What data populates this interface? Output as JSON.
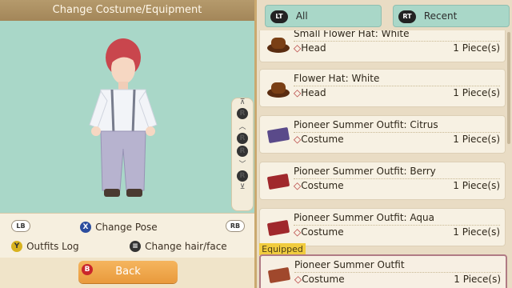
{
  "header": {
    "title": "Change Costume/Equipment"
  },
  "controls": {
    "lb": "LB",
    "rb": "RB",
    "x_button": "X",
    "y_button": "Y",
    "change_pose": "Change Pose",
    "outfits_log": "Outfits Log",
    "change_hair": "Change hair/face"
  },
  "back": {
    "button_letter": "B",
    "label": "Back"
  },
  "dpad": {
    "top_label": "R",
    "bottom_label": "R",
    "mid_label": "R"
  },
  "filters": {
    "all": {
      "badge": "LT",
      "label": "All"
    },
    "recent": {
      "badge": "RT",
      "label": "Recent"
    }
  },
  "items": [
    {
      "name": "Small Flower Hat: White",
      "category": "Head",
      "qty": "1 Piece(s)",
      "color": "#7a3f15"
    },
    {
      "name": "Flower Hat: White",
      "category": "Head",
      "qty": "1 Piece(s)",
      "color": "#7a3f15"
    },
    {
      "name": "Pioneer Summer Outfit: Citrus",
      "category": "Costume",
      "qty": "1 Piece(s)",
      "color": "#5a4a8a"
    },
    {
      "name": "Pioneer Summer Outfit: Berry",
      "category": "Costume",
      "qty": "1 Piece(s)",
      "color": "#a0282c"
    },
    {
      "name": "Pioneer Summer Outfit: Aqua",
      "category": "Costume",
      "qty": "1 Piece(s)",
      "color": "#a0282c"
    }
  ],
  "equipped": {
    "tag": "Equipped",
    "name": "Pioneer Summer Outfit",
    "category": "Costume",
    "qty": "1 Piece(s)",
    "color": "#a0482c"
  },
  "diamond": "◇"
}
